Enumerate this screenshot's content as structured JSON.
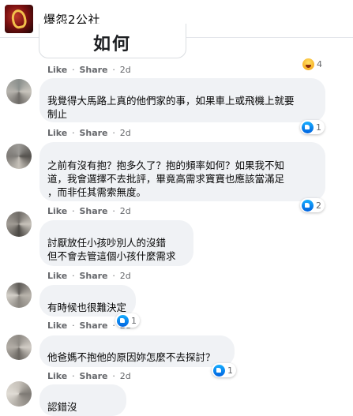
{
  "header": {
    "title": "爆怨2公社",
    "avatar_icon": "page-logo-icon"
  },
  "previous": {
    "card_text": "如何",
    "actions": {
      "like": "Like",
      "sep": "·",
      "share": "Share",
      "time": "2d"
    },
    "reactions": {
      "count": "4",
      "type": "haha-icon"
    }
  },
  "comments": [
    {
      "text_lines": [
        "我覺得大馬路上真的他們家的事，如果車上或飛機上就要",
        "制止"
      ],
      "actions": {
        "like": "Like",
        "sep": "·",
        "share": "Share",
        "time": "2d"
      },
      "reactions": {
        "count": "1",
        "type": "like-icon"
      }
    },
    {
      "text_lines": [
        "之前有沒有抱？抱多久了？抱的頻率如何？如果我不知",
        "道，我會選擇不去批評，畢竟高需求寶寶也應該當滿足",
        "，而非任其需索無度。"
      ],
      "actions": {
        "like": "Like",
        "sep": "·",
        "share": "Share",
        "time": "2d"
      },
      "reactions": {
        "count": "2",
        "type": "like-icon"
      }
    },
    {
      "text_lines": [
        "討厭放任小孩吵別人的沒錯",
        "但不會去管這個小孩什麼需求"
      ],
      "actions": {
        "like": "Like",
        "sep": "·",
        "share": "Share",
        "time": "2d"
      },
      "reactions": null
    },
    {
      "text_lines": [
        "有時候也很難決定"
      ],
      "actions": {
        "like": "Like",
        "sep": "·",
        "share": "Share",
        "time": "2d"
      },
      "reactions": {
        "count": "1",
        "type": "like-icon"
      }
    },
    {
      "text_lines": [
        "他爸媽不抱他的原因妳怎麼不去探討？"
      ],
      "actions": {
        "like": "Like",
        "sep": "·",
        "share": "Share",
        "time": "2d"
      },
      "reactions": {
        "count": "1",
        "type": "like-icon"
      }
    },
    {
      "text_lines": [
        "認錯沒"
      ],
      "actions": null,
      "reactions": null
    }
  ],
  "colors": {
    "bubble": "#f0f2f5",
    "meta": "#65676b",
    "like_blue": "#1877f2",
    "divider": "#e4e6eb"
  }
}
